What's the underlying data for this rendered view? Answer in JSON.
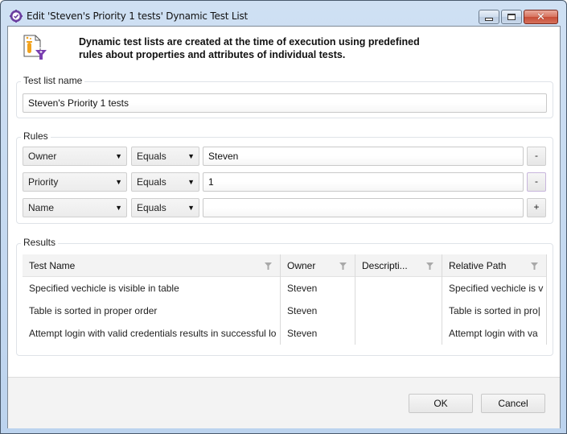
{
  "window": {
    "title": "Edit 'Steven's Priority 1 tests' Dynamic Test List",
    "app_icon": "gear-check-icon",
    "caption_buttons": {
      "minimize": "minimize-icon",
      "maximize": "maximize-icon",
      "close": "close-icon"
    }
  },
  "header": {
    "icon": "dynamic-test-list-icon",
    "description": "Dynamic test lists are created at the time of execution using predefined rules about properties and attributes of individual tests."
  },
  "test_list_name": {
    "label": "Test list name",
    "value": "Steven's Priority 1 tests"
  },
  "rules": {
    "label": "Rules",
    "items": [
      {
        "property": "Owner",
        "operator": "Equals",
        "value": "Steven",
        "action": "-"
      },
      {
        "property": "Priority",
        "operator": "Equals",
        "value": "1",
        "action": "-"
      },
      {
        "property": "Name",
        "operator": "Equals",
        "value": "",
        "action": "+"
      }
    ]
  },
  "results": {
    "label": "Results",
    "columns": [
      {
        "label": "Test Name"
      },
      {
        "label": "Owner"
      },
      {
        "label": "Descripti..."
      },
      {
        "label": "Relative Path"
      }
    ],
    "rows": [
      {
        "test_name": "Specified vechicle is visible in table",
        "owner": "Steven",
        "description": "",
        "relative_path": "Specified vechicle is v"
      },
      {
        "test_name": "Table is sorted in proper order",
        "owner": "Steven",
        "description": "",
        "relative_path": "Table is sorted in pro|"
      },
      {
        "test_name": "Attempt login with valid credentials results in successful lo",
        "owner": "Steven",
        "description": "",
        "relative_path": "Attempt login with va"
      }
    ]
  },
  "footer": {
    "ok_label": "OK",
    "cancel_label": "Cancel"
  },
  "colors": {
    "accent_purple": "#6b3fa0",
    "close_red": "#c74d37",
    "frame_blue": "#bcd3ee"
  }
}
